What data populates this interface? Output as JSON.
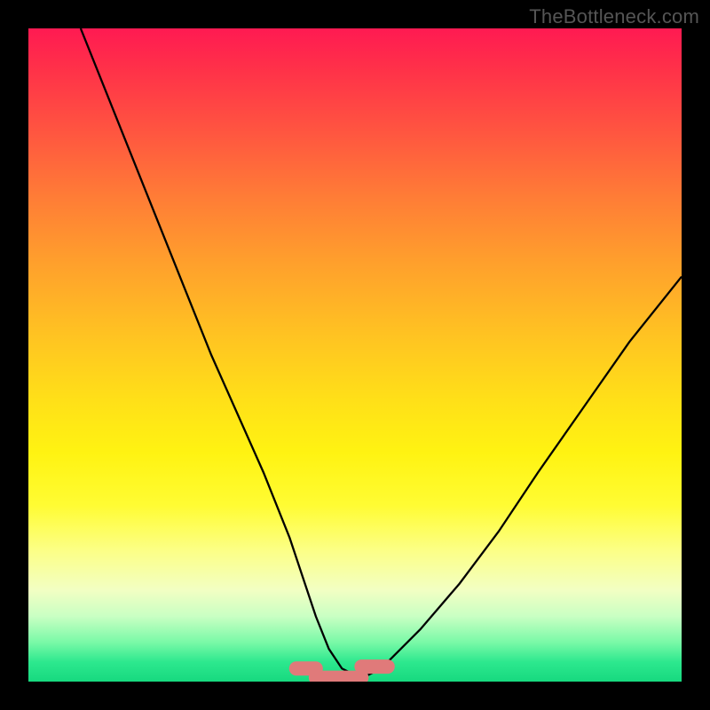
{
  "watermark": "TheBottleneck.com",
  "chart_data": {
    "type": "line",
    "title": "",
    "xlabel": "",
    "ylabel": "",
    "xlim": [
      0,
      100
    ],
    "ylim": [
      0,
      100
    ],
    "series": [
      {
        "name": "bottleneck-curve",
        "x": [
          8,
          12,
          16,
          20,
          24,
          28,
          32,
          36,
          40,
          42,
          44,
          46,
          48,
          50,
          52,
          54,
          56,
          60,
          66,
          72,
          78,
          85,
          92,
          100
        ],
        "values": [
          100,
          90,
          80,
          70,
          60,
          50,
          41,
          32,
          22,
          16,
          10,
          5,
          2,
          1,
          1,
          2,
          4,
          8,
          15,
          23,
          32,
          42,
          52,
          62
        ]
      }
    ],
    "markers": [
      {
        "name": "segment-left",
        "x_range": [
          41,
          44
        ],
        "y": 2.0
      },
      {
        "name": "segment-middle",
        "x_range": [
          44,
          51
        ],
        "y": 0.6
      },
      {
        "name": "segment-right",
        "x_range": [
          51,
          55
        ],
        "y": 2.3
      }
    ],
    "colors": {
      "curve": "#000000",
      "marker": "#e07a7a"
    }
  }
}
